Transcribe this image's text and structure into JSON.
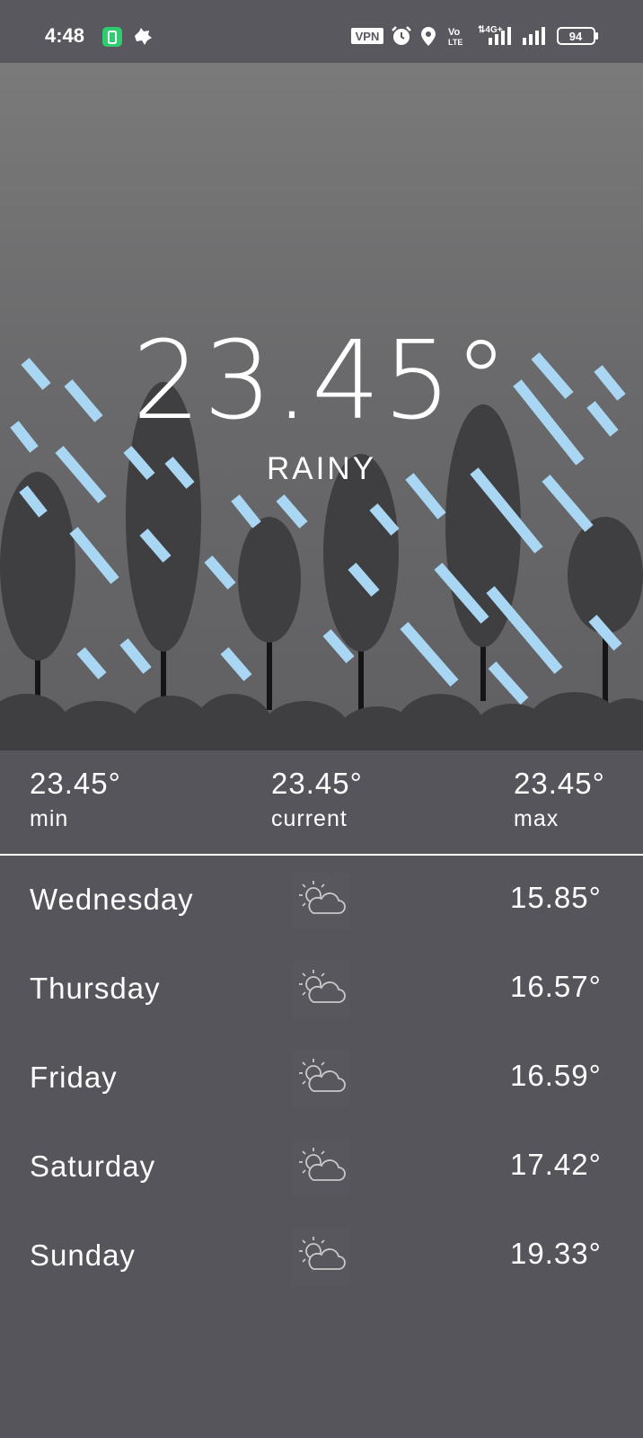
{
  "status_bar": {
    "time": "4:48",
    "battery_level": "94",
    "vpn": "VPN",
    "network": "4G",
    "volte": "Vo LTE"
  },
  "current": {
    "temperature": "23.45°",
    "condition": "RAINY"
  },
  "summary": [
    {
      "value": "23.45°",
      "label": "min"
    },
    {
      "value": "23.45°",
      "label": "current"
    },
    {
      "value": "23.45°",
      "label": "max"
    }
  ],
  "forecast": [
    {
      "day": "Wednesday",
      "temp": "15.85°",
      "icon": "partly-cloudy-icon"
    },
    {
      "day": "Thursday",
      "temp": "16.57°",
      "icon": "partly-cloudy-icon"
    },
    {
      "day": "Friday",
      "temp": "16.59°",
      "icon": "partly-cloudy-icon"
    },
    {
      "day": "Saturday",
      "temp": "17.42°",
      "icon": "partly-cloudy-icon"
    },
    {
      "day": "Sunday",
      "temp": "19.33°",
      "icon": "partly-cloudy-icon"
    }
  ],
  "colors": {
    "background": "#56555b",
    "rain": "#a9d7f3",
    "trees": "#3f3f41"
  }
}
